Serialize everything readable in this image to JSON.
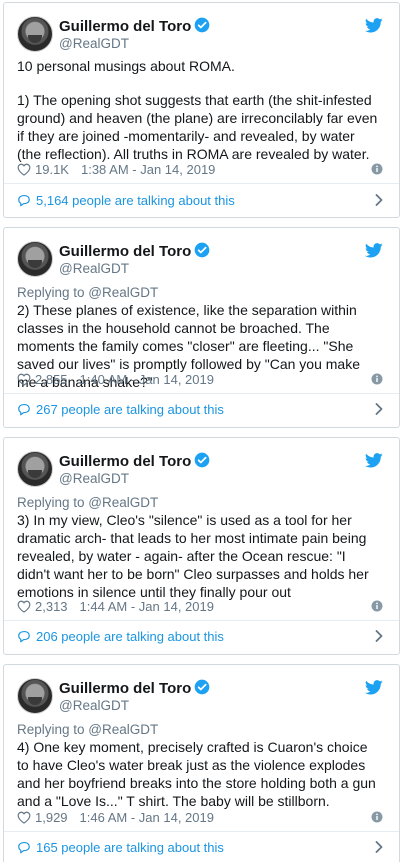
{
  "tweets": [
    {
      "name": "Guillermo del Toro",
      "handle": "@RealGDT",
      "intro": "10 personal musings about ROMA.",
      "reply_to": "",
      "text": "1) The opening shot suggests that earth (the shit-infested ground) and heaven (the plane) are irreconcilably far even if they are joined -momentarily- and revealed, by water (the reflection). All truths in ROMA are revealed by water.",
      "likes": "19.1K",
      "time": "1:38 AM - Jan 14, 2019",
      "talking": "5,164 people are talking about this"
    },
    {
      "name": "Guillermo del Toro",
      "handle": "@RealGDT",
      "reply_to": "Replying to @RealGDT",
      "text": "2) These planes of existence, like the separation within classes in the household cannot be broached.   The moments the family comes \"closer\" are fleeting... \"She saved our lives\" is promptly followed by \"Can you make me a banana shake?\"",
      "likes": "2,855",
      "time": "1:40 AM - Jan 14, 2019",
      "talking": "267 people are talking about this"
    },
    {
      "name": "Guillermo del Toro",
      "handle": "@RealGDT",
      "reply_to": "Replying to @RealGDT",
      "text": "3) In my view, Cleo's \"silence\" is used as a tool for her dramatic arch- that leads to her most intimate pain being revealed, by water - again-  after the Ocean rescue: \"I didn't want her to be born\" Cleo surpasses and holds her emotions in silence until they finally pour out",
      "likes": "2,313",
      "time": "1:44 AM - Jan 14, 2019",
      "talking": "206 people are talking about this"
    },
    {
      "name": "Guillermo del Toro",
      "handle": "@RealGDT",
      "reply_to": "Replying to @RealGDT",
      "text": "4) One key moment, precisely crafted is Cuaron's choice to have Cleo's water break just as the violence explodes and her boyfriend breaks into the store holding both a gun and a \"Love Is...\" T shirt.  The baby will be stillborn.",
      "likes": "1,929",
      "time": "1:46 AM - Jan 14, 2019",
      "talking": "165 people are talking about this"
    }
  ],
  "icons": {
    "avatar": "avatar",
    "verified": "verified-badge-icon",
    "bird": "twitter-bird-icon",
    "heart": "heart-icon",
    "info": "info-icon",
    "bubble": "comment-bubble-icon",
    "chevron": "chevron-right-icon"
  },
  "colors": {
    "accent": "#1da1f2",
    "link": "#1b95e0",
    "muted": "#657786",
    "border": "#d2dade"
  }
}
